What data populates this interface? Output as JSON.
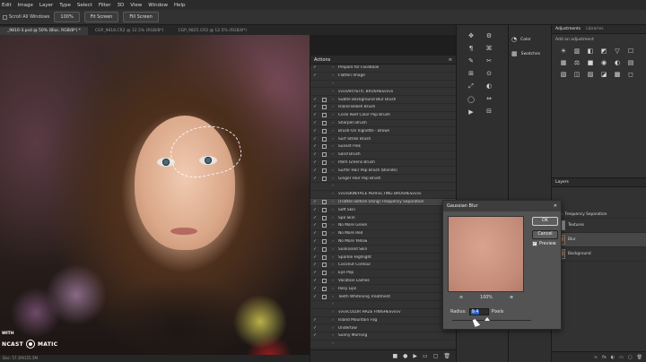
{
  "menu": [
    "Edit",
    "Image",
    "Layer",
    "Type",
    "Select",
    "Filter",
    "3D",
    "View",
    "Window",
    "Help"
  ],
  "options": {
    "scroll_all": "Scroll All Windows",
    "zoom": "100%",
    "fit_screen": "Fit Screen",
    "fill_screen": "Fill Screen"
  },
  "tabs": [
    "_9810-3.psd @ 50% (Blur, RGB/8*) *",
    "CGP_9818.CR2 @ 12.5% (RGB/8*)",
    "CGP_9825.CR2 @ 12.5% (RGB/8*)"
  ],
  "canvas": {
    "brand_with": "WITH",
    "brand_name_1": "NCAST",
    "brand_name_2": "MATIC",
    "status": "Doc: 57.1M/155.5M"
  },
  "actions": {
    "title": "Actions",
    "menu_icon": "≡",
    "rows": [
      {
        "check": "✓",
        "box": false,
        "arrow": "›",
        "label": "Prepare for Facebook",
        "hl": false
      },
      {
        "check": "✓",
        "box": false,
        "arrow": "›",
        "label": "Flatten Image",
        "hl": false
      },
      {
        "check": "",
        "box": false,
        "arrow": "›",
        "label": "",
        "hl": false
      },
      {
        "check": "",
        "box": false,
        "arrow": "›",
        "label": "vvvvARTISTIC BRUSHESvvvv",
        "hl": false
      },
      {
        "check": "✓",
        "box": true,
        "arrow": "›",
        "label": "Subtle Background Blur Brush",
        "hl": false
      },
      {
        "check": "✓",
        "box": true,
        "arrow": "›",
        "label": "Island Bokeh Brush",
        "hl": false
      },
      {
        "check": "✓",
        "box": true,
        "arrow": "›",
        "label": "Coral Reef Color Pop Brush",
        "hl": false
      },
      {
        "check": "✓",
        "box": true,
        "arrow": "›",
        "label": "Sharpen Brush",
        "hl": false
      },
      {
        "check": "✓",
        "box": true,
        "arrow": "›",
        "label": "Brush-On Vignette - Brown",
        "hl": false
      },
      {
        "check": "✓",
        "box": true,
        "arrow": "›",
        "label": "Surf Strike Brush",
        "hl": false
      },
      {
        "check": "✓",
        "box": true,
        "arrow": "›",
        "label": "Sunset Pink",
        "hl": false
      },
      {
        "check": "✓",
        "box": true,
        "arrow": "›",
        "label": "Sand Brush",
        "hl": false
      },
      {
        "check": "✓",
        "box": true,
        "arrow": "›",
        "label": "Palm Greens Brush",
        "hl": false
      },
      {
        "check": "✓",
        "box": true,
        "arrow": "›",
        "label": "Surfer Hair Pop Brush (Blonde)",
        "hl": false
      },
      {
        "check": "✓",
        "box": true,
        "arrow": "›",
        "label": "Ginger Hair Pop Brush",
        "hl": false
      },
      {
        "check": "",
        "box": false,
        "arrow": "›",
        "label": "",
        "hl": false
      },
      {
        "check": "",
        "box": false,
        "arrow": "›",
        "label": "vvvvSKIN/FACE PERFECTING BRUSHESvvvv",
        "hl": false
      },
      {
        "check": "✓",
        "box": true,
        "arrow": "›",
        "label": "(Flatten Before Using) Frequency Separation",
        "hl": true
      },
      {
        "check": "✓",
        "box": true,
        "arrow": "›",
        "label": "Soft Skin",
        "hl": false
      },
      {
        "check": "✓",
        "box": true,
        "arrow": "›",
        "label": "Spa Skin",
        "hl": false
      },
      {
        "check": "✓",
        "box": true,
        "arrow": "›",
        "label": "No More Green",
        "hl": false
      },
      {
        "check": "✓",
        "box": true,
        "arrow": "›",
        "label": "No More Red",
        "hl": false
      },
      {
        "check": "✓",
        "box": true,
        "arrow": "›",
        "label": "No More Yellow",
        "hl": false
      },
      {
        "check": "✓",
        "box": true,
        "arrow": "›",
        "label": "Sunkissed Skin",
        "hl": false
      },
      {
        "check": "✓",
        "box": true,
        "arrow": "›",
        "label": "Sparkle Highlight",
        "hl": false
      },
      {
        "check": "✓",
        "box": true,
        "arrow": "›",
        "label": "Coconut Contour",
        "hl": false
      },
      {
        "check": "✓",
        "box": true,
        "arrow": "›",
        "label": "Eye Pop",
        "hl": false
      },
      {
        "check": "✓",
        "box": true,
        "arrow": "›",
        "label": "Vacation Lashes",
        "hl": false
      },
      {
        "check": "✓",
        "box": true,
        "arrow": "›",
        "label": "Rosy Lips",
        "hl": false
      },
      {
        "check": "✓",
        "box": true,
        "arrow": "›",
        "label": "Teeth Whitening Treatment",
        "hl": false
      },
      {
        "check": "",
        "box": false,
        "arrow": "›",
        "label": "",
        "hl": false
      },
      {
        "check": "",
        "box": false,
        "arrow": "›",
        "label": "vvvvCOLOR HAZE FINISHESvvvv",
        "hl": false
      },
      {
        "check": "✓",
        "box": false,
        "arrow": "›",
        "label": "Island Mountain Fog",
        "hl": false
      },
      {
        "check": "✓",
        "box": false,
        "arrow": "›",
        "label": "Undertow",
        "hl": false
      },
      {
        "check": "✓",
        "box": false,
        "arrow": "›",
        "label": "Sunny Morning",
        "hl": false
      },
      {
        "check": "",
        "box": false,
        "arrow": "›",
        "label": "",
        "hl": false
      },
      {
        "check": "",
        "box": false,
        "arrow": "›",
        "label": "vvvvMATTE FINISHESvvvv",
        "hl": false
      }
    ],
    "footer_icons": [
      "■",
      "●",
      "▶",
      "▭",
      "▢",
      "🗑"
    ]
  },
  "tools": {
    "col1": [
      "✥",
      "¶",
      "✎",
      "⊞",
      "⤢",
      "◯",
      "▶"
    ],
    "col2": [
      "⚙",
      "⌘",
      "✂",
      "⊙",
      "◐",
      "⇔",
      "⊟"
    ]
  },
  "color_panel": {
    "color_label": "Color",
    "swatches_label": "Swatches"
  },
  "adjustments": {
    "tab_adjustments": "Adjustments",
    "tab_libraries": "Libraries",
    "hint": "Add an adjustment",
    "icons": [
      "☀",
      "▥",
      "◧",
      "◩",
      "▽",
      "☐",
      "▦",
      "⚖",
      "■",
      "◉",
      "◐",
      "▤",
      "▧",
      "◫",
      "▨",
      "◪",
      "▩",
      "◻"
    ]
  },
  "layers": {
    "title": "Layers",
    "group_name": "Frequency Separation",
    "items": [
      {
        "name": "Textures",
        "thumb": "gray",
        "selected": false
      },
      {
        "name": "Blur",
        "thumb": "photo",
        "selected": true
      },
      {
        "name": "Background",
        "thumb": "photo",
        "selected": false
      }
    ],
    "footer_icons": [
      "∞",
      "fx",
      "◐",
      "▭",
      "▢",
      "🗑"
    ]
  },
  "dialog": {
    "title": "Gaussian Blur",
    "close": "✕",
    "ok_label": "OK",
    "reset_label": "Cancel",
    "preview_label": "Preview",
    "preview_checked": "✓",
    "zoom_value": "100%",
    "zoom_out": "⊖",
    "zoom_in": "⊕",
    "radius_label": "Radius:",
    "radius_value": "9.4",
    "radius_unit": "Pixels"
  }
}
